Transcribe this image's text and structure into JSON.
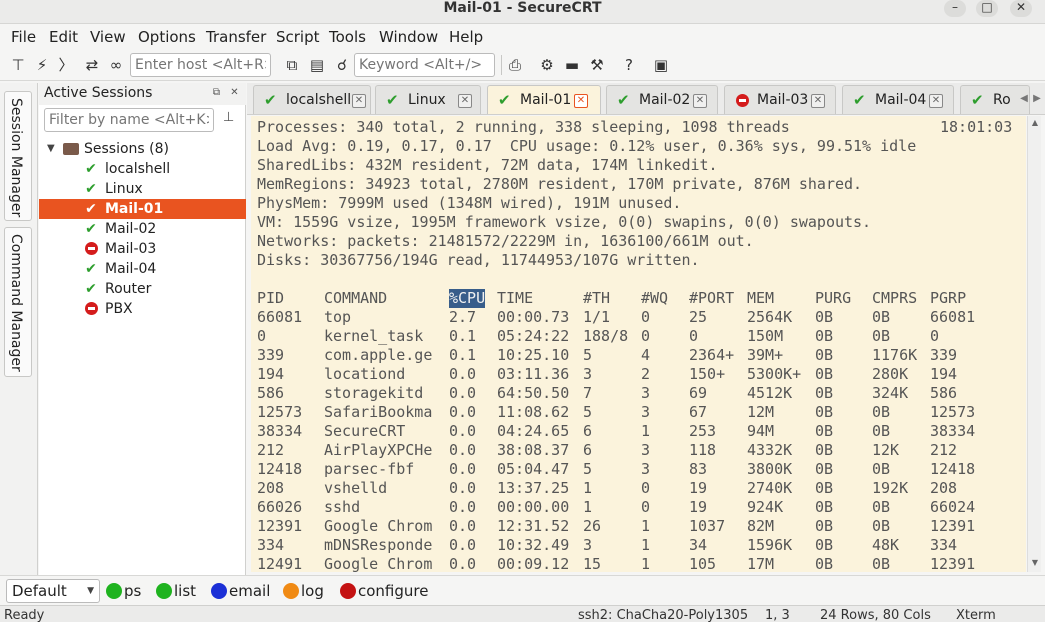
{
  "window": {
    "title": "Mail-01 - SecureCRT"
  },
  "menubar": {
    "items": [
      "File",
      "Edit",
      "View",
      "Options",
      "Transfer",
      "Script",
      "Tools",
      "Window",
      "Help"
    ]
  },
  "toolbar": {
    "host_placeholder": "Enter host <Alt+R>",
    "keyword_placeholder": "Keyword <Alt+/>"
  },
  "side_tabs": {
    "session_manager": "Session Manager",
    "command_manager": "Command Manager"
  },
  "sessions_panel": {
    "title": "Active Sessions",
    "filter_placeholder": "Filter by name <Alt+K>",
    "root": "Sessions (8)",
    "items": [
      {
        "label": "localshell",
        "status": "ok"
      },
      {
        "label": "Linux",
        "status": "ok"
      },
      {
        "label": "Mail-01",
        "status": "ok"
      },
      {
        "label": "Mail-02",
        "status": "ok"
      },
      {
        "label": "Mail-03",
        "status": "error"
      },
      {
        "label": "Mail-04",
        "status": "ok"
      },
      {
        "label": "Router",
        "status": "ok"
      },
      {
        "label": "PBX",
        "status": "error"
      }
    ],
    "selected": "Mail-01"
  },
  "tabs": [
    {
      "label": "localshell",
      "status": "ok"
    },
    {
      "label": "Linux",
      "status": "ok"
    },
    {
      "label": "Mail-01",
      "status": "ok",
      "active": true
    },
    {
      "label": "Mail-02",
      "status": "ok"
    },
    {
      "label": "Mail-03",
      "status": "error"
    },
    {
      "label": "Mail-04",
      "status": "ok"
    },
    {
      "label": "Ro",
      "status": "ok"
    }
  ],
  "terminal": {
    "clock": "18:01:03",
    "summary": [
      "Processes: 340 total, 2 running, 338 sleeping, 1098 threads",
      "Load Avg: 0.19, 0.17, 0.17  CPU usage: 0.12% user, 0.36% sys, 99.51% idle",
      "SharedLibs: 432M resident, 72M data, 174M linkedit.",
      "MemRegions: 34923 total, 2780M resident, 170M private, 876M shared.",
      "PhysMem: 7999M used (1348M wired), 191M unused.",
      "VM: 1559G vsize, 1995M framework vsize, 0(0) swapins, 0(0) swapouts.",
      "Networks: packets: 21481572/2229M in, 1636100/661M out.",
      "Disks: 30367756/194G read, 11744953/107G written."
    ],
    "columns": [
      "PID",
      "COMMAND",
      "%CPU",
      "TIME",
      "#TH",
      "#WQ",
      "#PORT",
      "MEM",
      "PURG",
      "CMPRS",
      "PGRP"
    ],
    "highlighted_column": "%CPU",
    "rows": [
      [
        "66081",
        "top",
        "2.7",
        "00:00.73",
        "1/1",
        "0",
        "25",
        "2564K",
        "0B",
        "0B",
        "66081"
      ],
      [
        "0",
        "kernel_task",
        "0.1",
        "05:24:22",
        "188/8",
        "0",
        "0",
        "150M",
        "0B",
        "0B",
        "0"
      ],
      [
        "339",
        "com.apple.ge",
        "0.1",
        "10:25.10",
        "5",
        "4",
        "2364+",
        "39M+",
        "0B",
        "1176K",
        "339"
      ],
      [
        "194",
        "locationd",
        "0.0",
        "03:11.36",
        "3",
        "2",
        "150+",
        "5300K+",
        "0B",
        "280K",
        "194"
      ],
      [
        "586",
        "storagekitd",
        "0.0",
        "64:50.50",
        "7",
        "3",
        "69",
        "4512K",
        "0B",
        "324K",
        "586"
      ],
      [
        "12573",
        "SafariBookma",
        "0.0",
        "11:08.62",
        "5",
        "3",
        "67",
        "12M",
        "0B",
        "0B",
        "12573"
      ],
      [
        "38334",
        "SecureCRT",
        "0.0",
        "04:24.65",
        "6",
        "1",
        "253",
        "94M",
        "0B",
        "0B",
        "38334"
      ],
      [
        "212",
        "AirPlayXPCHe",
        "0.0",
        "38:08.37",
        "6",
        "3",
        "118",
        "4332K",
        "0B",
        "12K",
        "212"
      ],
      [
        "12418",
        "parsec-fbf",
        "0.0",
        "05:04.47",
        "5",
        "3",
        "83",
        "3800K",
        "0B",
        "0B",
        "12418"
      ],
      [
        "208",
        "vshelld",
        "0.0",
        "13:37.25",
        "1",
        "0",
        "19",
        "2740K",
        "0B",
        "192K",
        "208"
      ],
      [
        "66026",
        "sshd",
        "0.0",
        "00:00.00",
        "1",
        "0",
        "19",
        "924K",
        "0B",
        "0B",
        "66024"
      ],
      [
        "12391",
        "Google Chrom",
        "0.0",
        "12:31.52",
        "26",
        "1",
        "1037",
        "82M",
        "0B",
        "0B",
        "12391"
      ],
      [
        "334",
        "mDNSResponde",
        "0.0",
        "10:32.49",
        "3",
        "1",
        "34",
        "1596K",
        "0B",
        "48K",
        "334"
      ],
      [
        "12491",
        "Google Chrom",
        "0.0",
        "00:09.12",
        "15",
        "1",
        "105",
        "17M",
        "0B",
        "0B",
        "12391"
      ]
    ]
  },
  "button_bar": {
    "group": "Default",
    "buttons": [
      {
        "label": "ps",
        "color": "#1fb31f"
      },
      {
        "label": "list",
        "color": "#1fb31f"
      },
      {
        "label": "email",
        "color": "#1b2fd6"
      },
      {
        "label": "log",
        "color": "#f08a14"
      },
      {
        "label": "configure",
        "color": "#c41212"
      }
    ]
  },
  "status_bar": {
    "state": "Ready",
    "cipher": "ssh2: ChaCha20-Poly1305",
    "cursor": "1,  3",
    "size": "24 Rows, 80 Cols",
    "terminal_type": "Xterm"
  },
  "colors": {
    "accent": "#e95420",
    "terminal_bg": "#fbf3dc",
    "ok": "#2e9e2e",
    "error": "#d41c1c",
    "highlight": "#385d8a"
  }
}
